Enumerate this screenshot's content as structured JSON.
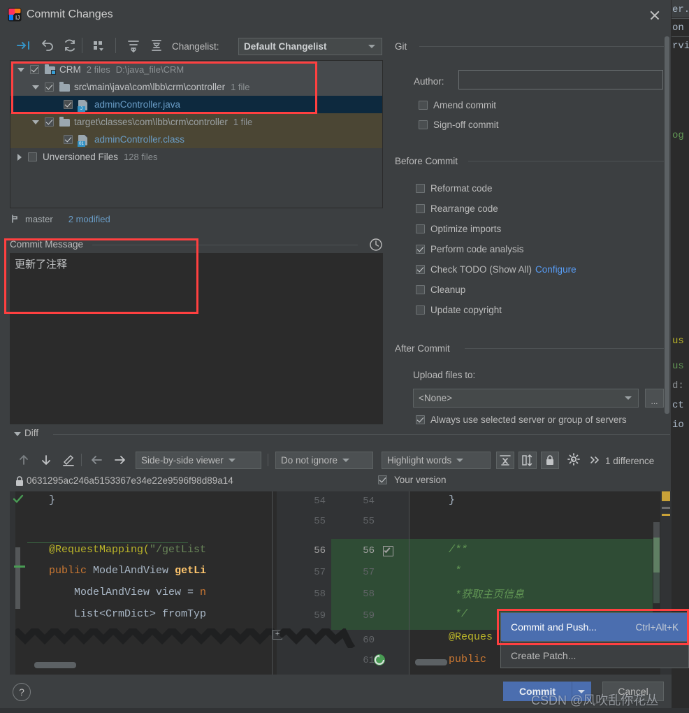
{
  "window": {
    "title": "Commit Changes",
    "app_icon": "intellij-idea-icon",
    "close_icon": "close-icon"
  },
  "toolbar": {
    "icons": [
      {
        "name": "show-diff-icon",
        "glyph": "⇥"
      },
      {
        "name": "revert-icon",
        "glyph": "↶"
      },
      {
        "name": "refresh-icon",
        "glyph": "↻"
      },
      {
        "name": "group-by-icon",
        "glyph": "∷"
      },
      {
        "name": "expand-all-icon",
        "glyph": "⤓"
      },
      {
        "name": "collapse-all-icon",
        "glyph": "⤒"
      }
    ],
    "changelist_label": "Changelist:",
    "changelist_value": "Default Changelist"
  },
  "file_tree": [
    {
      "name": "CRM",
      "meta_count": "2 files",
      "meta_path": "D:\\java_file\\CRM",
      "indent": 0,
      "checked": true,
      "expanded": true,
      "icon": "folder-modified-icon",
      "state": "hovered",
      "kind": "folder"
    },
    {
      "name": "src\\main\\java\\com\\lbb\\crm\\controller",
      "meta_count": "1 file",
      "meta_path": "",
      "indent": 1,
      "checked": true,
      "expanded": true,
      "icon": "folder-icon",
      "state": "hovered",
      "kind": "folder"
    },
    {
      "name": "adminController.java",
      "meta_count": "",
      "meta_path": "",
      "indent": 2,
      "checked": true,
      "expanded": null,
      "icon": "java-file-icon",
      "badge": "J",
      "state": "selected",
      "kind": "file"
    },
    {
      "name": "target\\classes\\com\\lbb\\crm\\controller",
      "meta_count": "1 file",
      "meta_path": "",
      "indent": 1,
      "checked": true,
      "expanded": true,
      "icon": "folder-icon",
      "state": "ignored",
      "kind": "folder"
    },
    {
      "name": "adminController.class",
      "meta_count": "",
      "meta_path": "",
      "indent": 2,
      "checked": true,
      "expanded": null,
      "icon": "class-file-icon",
      "badge": "01",
      "state": "ignored",
      "kind": "file"
    },
    {
      "name": "Unversioned Files",
      "meta_count": "128 files",
      "meta_path": "",
      "indent": 0,
      "checked": false,
      "expanded": false,
      "icon": "none",
      "state": "normal",
      "kind": "group"
    }
  ],
  "branch": {
    "icon": "branch-icon",
    "name": "master",
    "modified": "2 modified"
  },
  "commit_message": {
    "title": "Commit Message",
    "title_mnemonic": "C",
    "value": "更新了注释",
    "history_icon": "clock-history-icon"
  },
  "git_section": {
    "title": "Git",
    "author_label": "Author:",
    "author_mnemonic": "A",
    "author_value": "",
    "checkboxes": [
      {
        "label": "Amend commit",
        "mnemonic": "m",
        "checked": false,
        "name": "amend-commit-checkbox"
      },
      {
        "label": "Sign-off commit",
        "mnemonic": "g",
        "checked": false,
        "name": "sign-off-commit-checkbox"
      }
    ]
  },
  "before_commit": {
    "title": "Before Commit",
    "checkboxes": [
      {
        "label": "Reformat code",
        "mnemonic": "R",
        "checked": false,
        "name": "reformat-code-checkbox",
        "link": ""
      },
      {
        "label": "Rearrange code",
        "mnemonic": "n",
        "checked": false,
        "name": "rearrange-code-checkbox",
        "link": ""
      },
      {
        "label": "Optimize imports",
        "mnemonic": "O",
        "checked": false,
        "name": "optimize-imports-checkbox",
        "link": ""
      },
      {
        "label": "Perform code analysis",
        "mnemonic": "s",
        "checked": true,
        "name": "perform-code-analysis-checkbox",
        "link": ""
      },
      {
        "label": "Check TODO (Show All)",
        "mnemonic": "",
        "checked": true,
        "name": "check-todo-checkbox",
        "link": "Configure"
      },
      {
        "label": "Cleanup",
        "mnemonic": "l",
        "checked": false,
        "name": "cleanup-checkbox",
        "link": ""
      },
      {
        "label": "Update copyright",
        "mnemonic": "",
        "checked": false,
        "name": "update-copyright-checkbox",
        "link": ""
      }
    ]
  },
  "after_commit": {
    "title": "After Commit",
    "upload_label": "Upload files to:",
    "upload_value": "<None>",
    "browse_label": "...",
    "always_use_label": "Always use selected server or group of servers",
    "always_use_checked": true
  },
  "diff": {
    "section_title": "Diff",
    "toolbar": {
      "prev_diff_icon": "arrow-up-icon",
      "next_diff_icon": "arrow-down-icon",
      "edit_icon": "pencil-icon",
      "accept_left_icon": "arrow-left-icon",
      "accept_right_icon": "arrow-right-icon",
      "viewer_mode": "Side-by-side viewer",
      "ignore_mode": "Do not ignore",
      "highlight_mode": "Highlight words",
      "collapse_unchanged_icon": "collapse-unchanged-icon",
      "sync_scroll_icon": "sync-scroll-icon",
      "readonly_icon": "lock-icon",
      "settings_icon": "gear-icon",
      "overflow_icon": "chevron-double-right-icon",
      "difference_count": "1 difference"
    },
    "revision_lock_icon": "lock-icon",
    "revision_hash": "0631295ac246a5153367e34e22e9596f98d89a14",
    "your_version_label": "Your version",
    "your_version_checked": true,
    "left_lines": [
      {
        "num": "54",
        "segments": [
          {
            "t": "    }",
            "c": "plain"
          }
        ]
      },
      {
        "num": "55",
        "segments": [
          {
            "t": "",
            "c": "plain"
          }
        ]
      },
      {
        "num": "56",
        "segments": [
          {
            "t": "    @RequestMapping(",
            "c": "anno"
          },
          {
            "t": "\"/getList",
            "c": "str"
          }
        ],
        "changed": true
      },
      {
        "num": "57",
        "segments": [
          {
            "t": "    public ",
            "c": "kw"
          },
          {
            "t": "ModelAndView ",
            "c": "cls"
          },
          {
            "t": "getLi",
            "c": "mth"
          }
        ],
        "changed": true
      },
      {
        "num": "58",
        "segments": [
          {
            "t": "        ModelAndView view = ",
            "c": "cls"
          },
          {
            "t": "n",
            "c": "kw"
          }
        ],
        "changed": true
      },
      {
        "num": "59",
        "segments": [
          {
            "t": "        List<CrmDict> fromTyp",
            "c": "cls"
          }
        ],
        "changed": true
      }
    ],
    "right_lines": [
      {
        "num": "54",
        "segments": [
          {
            "t": "    }",
            "c": "plain"
          }
        ]
      },
      {
        "num": "55",
        "segments": [
          {
            "t": "",
            "c": "plain"
          }
        ]
      },
      {
        "num": "56",
        "segments": [
          {
            "t": "    /**",
            "c": "cmt"
          }
        ],
        "added": true,
        "marked": true
      },
      {
        "num": "57",
        "segments": [
          {
            "t": "     *",
            "c": "cmt"
          }
        ],
        "added": true
      },
      {
        "num": "58",
        "segments": [
          {
            "t": "     *获取主页信息",
            "c": "cmt"
          }
        ],
        "added": true
      },
      {
        "num": "59",
        "segments": [
          {
            "t": "     */",
            "c": "cmt"
          }
        ],
        "added": true
      },
      {
        "num": "60",
        "segments": [
          {
            "t": "    @Reques",
            "c": "anno"
          }
        ]
      },
      {
        "num": "61",
        "segments": [
          {
            "t": "    public",
            "c": "kw"
          }
        ]
      }
    ]
  },
  "context_menu": {
    "items": [
      {
        "label": "Commit and Push...",
        "mnemonic": "P",
        "shortcut": "Ctrl+Alt+K",
        "highlighted": true,
        "name": "commit-and-push-menu-item"
      },
      {
        "label": "Create Patch...",
        "mnemonic": "",
        "shortcut": "",
        "highlighted": false,
        "name": "create-patch-menu-item"
      }
    ]
  },
  "buttons": {
    "help": "?",
    "commit": "Commit",
    "commit_dropdown_icon": "chevron-down-icon",
    "cancel": "Cancel"
  },
  "watermark": "CSDN @风吹乱你花丛",
  "background_ide": {
    "fragments": [
      "er.j",
      "on",
      "rvi",
      "og",
      "us",
      "us",
      "d:",
      "ct",
      "io"
    ]
  },
  "colors": {
    "dialog_bg": "#3c3f41",
    "editor_bg": "#2b2b2b",
    "selection_blue": "#0d293e",
    "ignored_olive": "#4b4634",
    "accent_blue": "#4b6eaf",
    "link_blue": "#589df6",
    "annotation_red": "#ff4040",
    "added_green": "#2f4c35"
  }
}
